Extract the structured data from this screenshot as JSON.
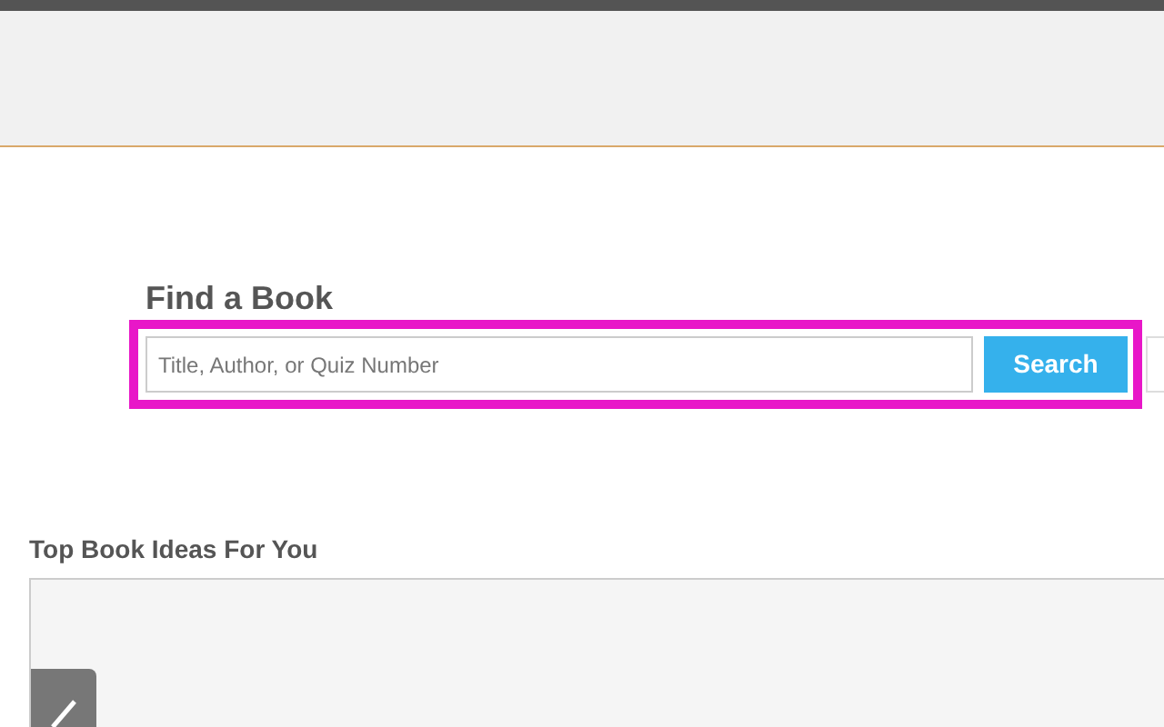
{
  "find_book": {
    "title": "Find a Book",
    "search": {
      "placeholder": "Title, Author, or Quiz Number"
    },
    "button": "Search"
  },
  "top_ideas": {
    "title": "Top Book Ideas For You"
  }
}
